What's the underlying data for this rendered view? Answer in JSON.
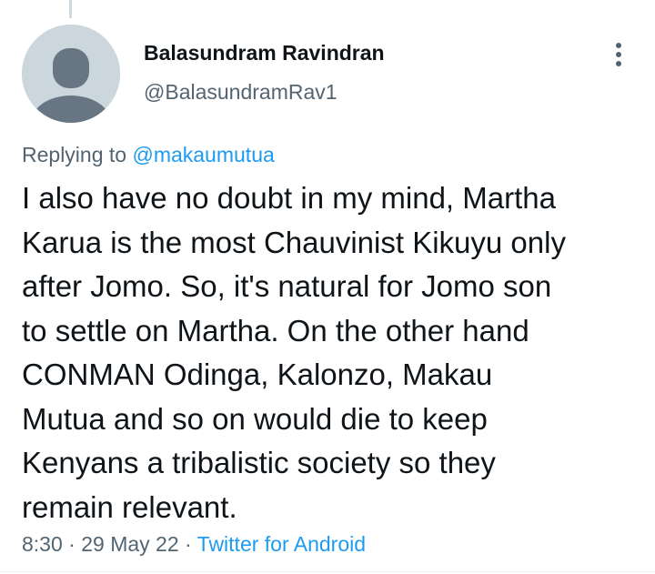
{
  "tweet": {
    "author": {
      "display_name": "Balasundram Ravindran",
      "handle": "@BalasundramRav1"
    },
    "replying_to": {
      "prefix": "Replying to",
      "mention": "@makaumutua"
    },
    "text": "I also have no doubt in my mind, Martha\nKarua is the most Chauvinist Kikuyu only\nafter Jomo. So, it's natural for Jomo son\nto settle on Martha. On the other hand\nCONMAN Odinga, Kalonzo, Makau\nMutua and so on would die to keep\nKenyans a tribalistic society so they\nremain relevant.",
    "time": "8:30",
    "separator": "·",
    "date": "29 May 22",
    "source": "Twitter for Android"
  },
  "icons": {
    "avatar": "default-profile-avatar",
    "more": "more-vertical-icon"
  },
  "colors": {
    "text_primary": "#0f1419",
    "text_secondary": "#536471",
    "accent": "#1d9bf0",
    "avatar_bg": "#ccd6dd",
    "avatar_figure": "#687684"
  }
}
